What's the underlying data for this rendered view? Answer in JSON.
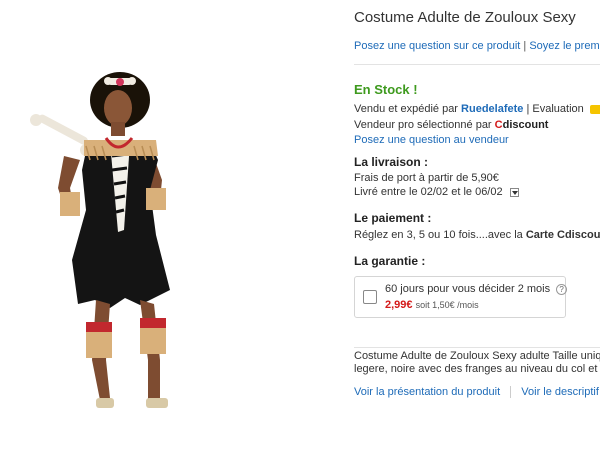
{
  "product": {
    "title": "Costume Adulte de Zouloux Sexy",
    "ask_question": "Posez une question sur ce produit",
    "be_first": "Soyez le premier"
  },
  "seller": {
    "stock": "En Stock !",
    "sold_by_prefix": "Vendu et expédié par",
    "seller_name": "Ruedelafete",
    "evaluation_label": "Evaluation",
    "pro_prefix": "Vendeur pro sélectionné par",
    "cdiscount_c": "C",
    "cdiscount_rest": "discount",
    "ask_seller": "Posez une question au vendeur"
  },
  "delivery": {
    "heading": "La livraison :",
    "shipping": "Frais de port à partir de 5,90€",
    "dates": "Livré entre le 02/02 et le 06/02"
  },
  "payment": {
    "heading": "Le paiement :",
    "text_prefix": "Réglez en 3, 5 ou 10 fois....avec la",
    "card_bold": "Carte Cdiscount"
  },
  "guarantee": {
    "heading": "La garantie :",
    "option": "60 jours pour vous décider 2 mois",
    "price": "2,99€",
    "monthly": "soit 1,50€ /mois"
  },
  "description": {
    "line1": "Costume Adulte de Zouloux Sexy adulte Taille unique",
    "line2": "legere, noire avec des franges au niveau du col et ...",
    "see_presentation": "Voir la présentation du produit",
    "see_description": "Voir le descriptif tec"
  },
  "colors": {
    "link": "#1e6bb8",
    "stock_green": "#3e9a1e",
    "price_red": "#d41a1a",
    "rating_yellow": "#f5c400"
  }
}
